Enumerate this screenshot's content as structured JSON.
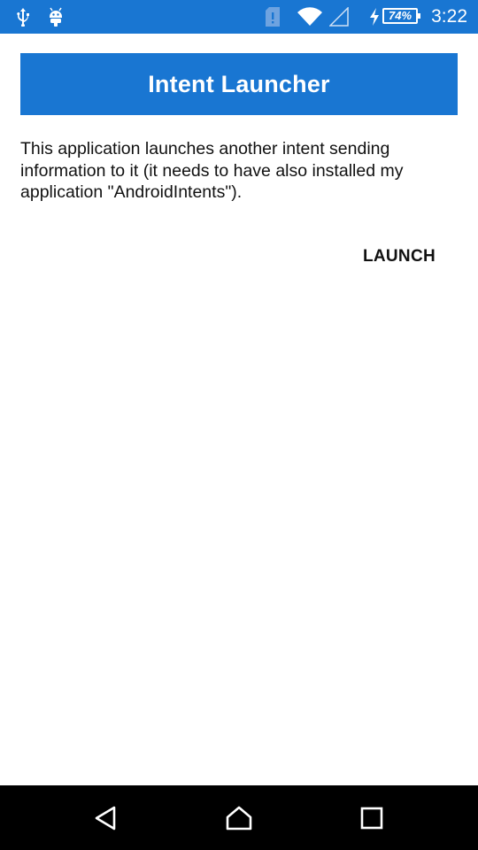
{
  "status_bar": {
    "time": "3:22",
    "battery_percent": "74%",
    "background_color": "#1976d2",
    "icons": [
      "usb-icon",
      "android-debug-icon",
      "sim-alert-icon",
      "wifi-icon",
      "signal-icon",
      "charging-bolt-icon",
      "battery-icon"
    ]
  },
  "header": {
    "title": "Intent Launcher",
    "background_color": "#1976d2"
  },
  "main": {
    "description": "This application launches another intent sending information to it (it needs to have also installed my application \"AndroidIntents\").",
    "launch_label": "LAUNCH"
  },
  "nav_bar": {
    "icons": [
      "back-icon",
      "home-icon",
      "recents-icon"
    ]
  }
}
